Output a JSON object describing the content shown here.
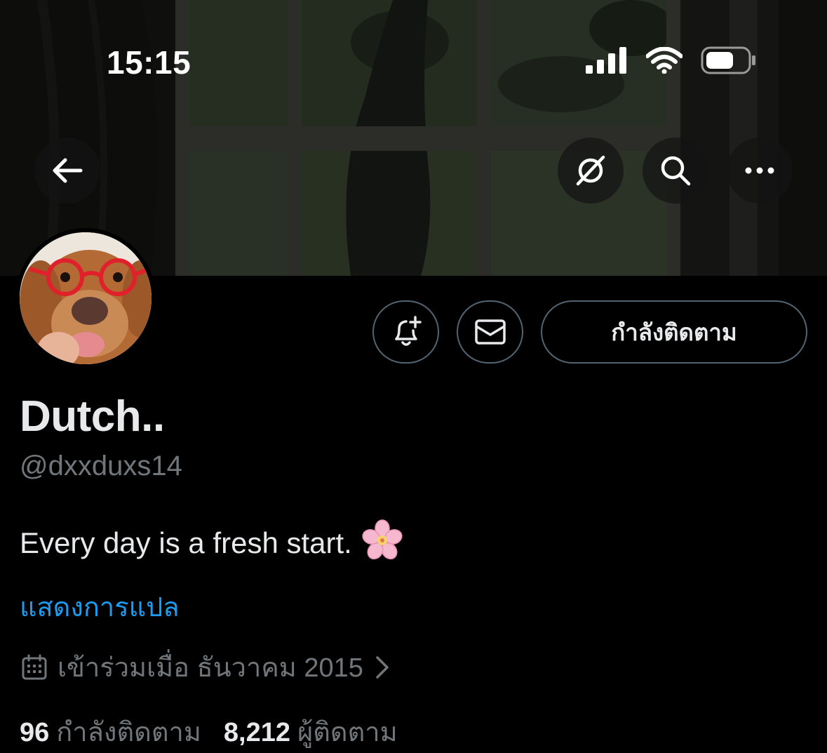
{
  "status_bar": {
    "time": "15:15"
  },
  "profile": {
    "display_name": "Dutch..",
    "handle": "@dxxduxs14",
    "bio": "Every day is a fresh start.",
    "bio_emoji": "cherry-blossom",
    "translate_link": "แสดงการแปล",
    "joined": "เข้าร่วมเมื่อ ธันวาคม 2015",
    "following_count": "96",
    "following_label": "กำลังติดตาม",
    "followers_count": "8,212",
    "followers_label": "ผู้ติดตาม"
  },
  "actions": {
    "following_button": "กำลังติดตาม"
  },
  "icons": {
    "back": "arrow-left-icon",
    "grok": "grok-icon",
    "search": "search-icon",
    "more": "more-icon",
    "notify": "bell-plus-icon",
    "message": "envelope-icon",
    "calendar": "calendar-icon",
    "chevron": "chevron-right-icon"
  },
  "colors": {
    "background": "#000000",
    "text_primary": "#e7e9ea",
    "text_secondary": "#71767b",
    "link": "#1d9bf0",
    "border": "#536471"
  }
}
